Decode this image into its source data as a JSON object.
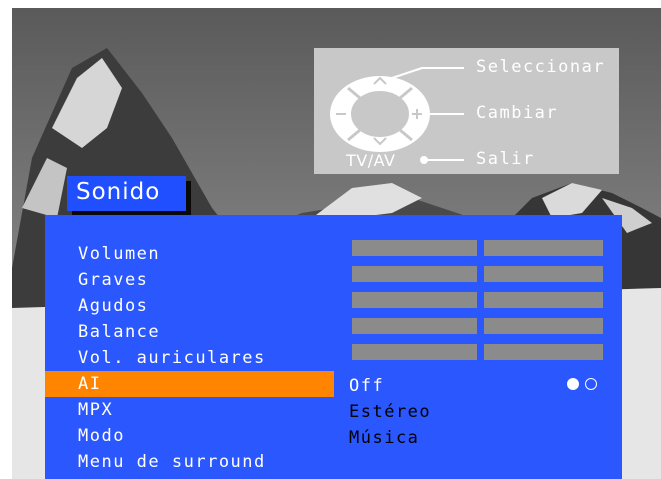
{
  "help": {
    "select_label": "Seleccionar",
    "change_label": "Cambiar",
    "exit_label": "Salir",
    "tvav_label": "TV/AV"
  },
  "menu": {
    "title": "Sonido",
    "items": [
      {
        "label": "Volumen"
      },
      {
        "label": "Graves"
      },
      {
        "label": "Agudos"
      },
      {
        "label": "Balance"
      },
      {
        "label": "Vol. auriculares"
      },
      {
        "label": "AI"
      },
      {
        "label": "MPX"
      },
      {
        "label": "Modo"
      },
      {
        "label": "Menu de surround"
      }
    ],
    "selected_index": 5,
    "values": {
      "ai": "Off",
      "mpx": "Estéreo",
      "modo": "Música"
    }
  },
  "colors": {
    "panel_blue": "#2b57ff",
    "title_blue": "#1f4fff",
    "highlight_orange": "#ff8400",
    "bar_gray": "#8b8b8b"
  }
}
